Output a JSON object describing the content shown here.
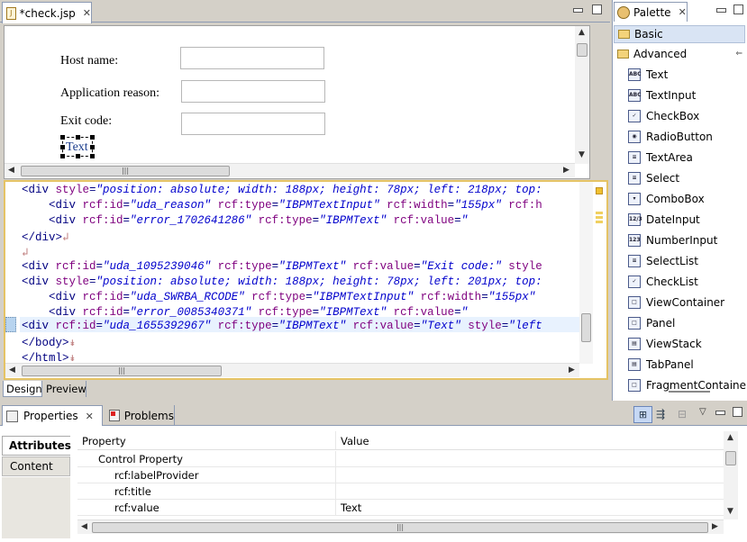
{
  "editor": {
    "tab_title": "*check.jsp",
    "bottom_tabs": [
      "Design",
      "Preview"
    ]
  },
  "design_form": {
    "host_label": "Host name:",
    "reason_label": "Application reason:",
    "exit_label": "Exit code:",
    "selected_text": "Text"
  },
  "source_lines": [
    [
      [
        "tag",
        "<div "
      ],
      [
        "attr",
        "style"
      ],
      [
        "tag",
        "="
      ],
      [
        "str",
        "\"position: absolute; width: 188px; height: 78px; left: 218px; top:"
      ]
    ],
    [
      [
        "tag",
        "    <div "
      ],
      [
        "attr",
        "rcf:id"
      ],
      [
        "tag",
        "="
      ],
      [
        "str",
        "\"uda_reason\""
      ],
      [
        "tag",
        " "
      ],
      [
        "attr",
        "rcf:type"
      ],
      [
        "tag",
        "="
      ],
      [
        "str",
        "\"IBPMTextInput\""
      ],
      [
        "tag",
        " "
      ],
      [
        "attr",
        "rcf:width"
      ],
      [
        "tag",
        "="
      ],
      [
        "str",
        "\"155px\""
      ],
      [
        "tag",
        " "
      ],
      [
        "attr",
        "rcf:h"
      ]
    ],
    [
      [
        "tag",
        "    <div "
      ],
      [
        "attr",
        "rcf:id"
      ],
      [
        "tag",
        "="
      ],
      [
        "str",
        "\"error_1702641286\""
      ],
      [
        "tag",
        " "
      ],
      [
        "attr",
        "rcf:type"
      ],
      [
        "tag",
        "="
      ],
      [
        "str",
        "\"IBPMText\""
      ],
      [
        "tag",
        " "
      ],
      [
        "attr",
        "rcf:value"
      ],
      [
        "tag",
        "="
      ],
      [
        "str",
        "\""
      ]
    ],
    [
      [
        "tag",
        "</div>"
      ],
      [
        "mark",
        "↲"
      ]
    ],
    [
      [
        "mark",
        "↲"
      ]
    ],
    [
      [
        "tag",
        "<div "
      ],
      [
        "attr",
        "rcf:id"
      ],
      [
        "tag",
        "="
      ],
      [
        "str",
        "\"uda_1095239046\""
      ],
      [
        "tag",
        " "
      ],
      [
        "attr",
        "rcf:type"
      ],
      [
        "tag",
        "="
      ],
      [
        "str",
        "\"IBPMText\""
      ],
      [
        "tag",
        " "
      ],
      [
        "attr",
        "rcf:value"
      ],
      [
        "tag",
        "="
      ],
      [
        "str",
        "\"Exit code:\""
      ],
      [
        "tag",
        " "
      ],
      [
        "attr",
        "style"
      ]
    ],
    [
      [
        "tag",
        "<div "
      ],
      [
        "attr",
        "style"
      ],
      [
        "tag",
        "="
      ],
      [
        "str",
        "\"position: absolute; width: 188px; height: 78px; left: 201px; top:"
      ]
    ],
    [
      [
        "tag",
        "    <div "
      ],
      [
        "attr",
        "rcf:id"
      ],
      [
        "tag",
        "="
      ],
      [
        "str",
        "\"uda_SWRBA_RCODE\""
      ],
      [
        "tag",
        " "
      ],
      [
        "attr",
        "rcf:type"
      ],
      [
        "tag",
        "="
      ],
      [
        "str",
        "\"IBPMTextInput\""
      ],
      [
        "tag",
        " "
      ],
      [
        "attr",
        "rcf:width"
      ],
      [
        "tag",
        "="
      ],
      [
        "str",
        "\"155px\""
      ]
    ],
    [
      [
        "tag",
        "    <div "
      ],
      [
        "attr",
        "rcf:id"
      ],
      [
        "tag",
        "="
      ],
      [
        "str",
        "\"error_0085340371\""
      ],
      [
        "tag",
        " "
      ],
      [
        "attr",
        "rcf:type"
      ],
      [
        "tag",
        "="
      ],
      [
        "str",
        "\"IBPMText\""
      ],
      [
        "tag",
        " "
      ],
      [
        "attr",
        "rcf:value"
      ],
      [
        "tag",
        "="
      ],
      [
        "str",
        "\""
      ]
    ],
    [
      [
        "tag",
        "<div "
      ],
      [
        "attr",
        "rcf:id"
      ],
      [
        "tag",
        "="
      ],
      [
        "str",
        "\"uda_1655392967\""
      ],
      [
        "tag",
        " "
      ],
      [
        "attr",
        "rcf:type"
      ],
      [
        "tag",
        "="
      ],
      [
        "str",
        "\"IBPMText\""
      ],
      [
        "tag",
        " "
      ],
      [
        "attr",
        "rcf:value"
      ],
      [
        "tag",
        "="
      ],
      [
        "str",
        "\"Text\""
      ],
      [
        "tag",
        " "
      ],
      [
        "attr",
        "style"
      ],
      [
        "tag",
        "="
      ],
      [
        "str",
        "\"left"
      ]
    ],
    [
      [
        "tag",
        "</body>"
      ],
      [
        "mark",
        "↡"
      ]
    ],
    [
      [
        "tag",
        "</html>"
      ],
      [
        "mark",
        "↡"
      ]
    ]
  ],
  "palette": {
    "title": "Palette",
    "drawers": [
      "Basic",
      "Advanced"
    ],
    "items": [
      {
        "label": "Text",
        "icon": "text-icon",
        "glyph": "ABC"
      },
      {
        "label": "TextInput",
        "icon": "textinput-icon",
        "glyph": "ABC"
      },
      {
        "label": "CheckBox",
        "icon": "checkbox-icon",
        "glyph": "✓"
      },
      {
        "label": "RadioButton",
        "icon": "radiobutton-icon",
        "glyph": "◉"
      },
      {
        "label": "TextArea",
        "icon": "textarea-icon",
        "glyph": "≡"
      },
      {
        "label": "Select",
        "icon": "select-icon",
        "glyph": "≡"
      },
      {
        "label": "ComboBox",
        "icon": "combobox-icon",
        "glyph": "▾"
      },
      {
        "label": "DateInput",
        "icon": "dateinput-icon",
        "glyph": "12/3"
      },
      {
        "label": "NumberInput",
        "icon": "numberinput-icon",
        "glyph": "123"
      },
      {
        "label": "SelectList",
        "icon": "selectlist-icon",
        "glyph": "≡"
      },
      {
        "label": "CheckList",
        "icon": "checklist-icon",
        "glyph": "✓"
      },
      {
        "label": "ViewContainer",
        "icon": "viewcontainer-icon",
        "glyph": "□"
      },
      {
        "label": "Panel",
        "icon": "panel-icon",
        "glyph": "□"
      },
      {
        "label": "ViewStack",
        "icon": "viewstack-icon",
        "glyph": "▤"
      },
      {
        "label": "TabPanel",
        "icon": "tabpanel-icon",
        "glyph": "▤"
      },
      {
        "label": "FragmentContainer",
        "icon": "fragmentcontainer-icon",
        "glyph": "□"
      }
    ]
  },
  "properties": {
    "tab_label": "Properties",
    "problems_label": "Problems",
    "side_tabs": [
      "Attributes",
      "Content"
    ],
    "col_property": "Property",
    "col_value": "Value",
    "rows": [
      {
        "key": "Control Property",
        "value": ""
      },
      {
        "key": "rcf:labelProvider",
        "value": ""
      },
      {
        "key": "rcf:title",
        "value": ""
      },
      {
        "key": "rcf:value",
        "value": "Text"
      }
    ]
  }
}
